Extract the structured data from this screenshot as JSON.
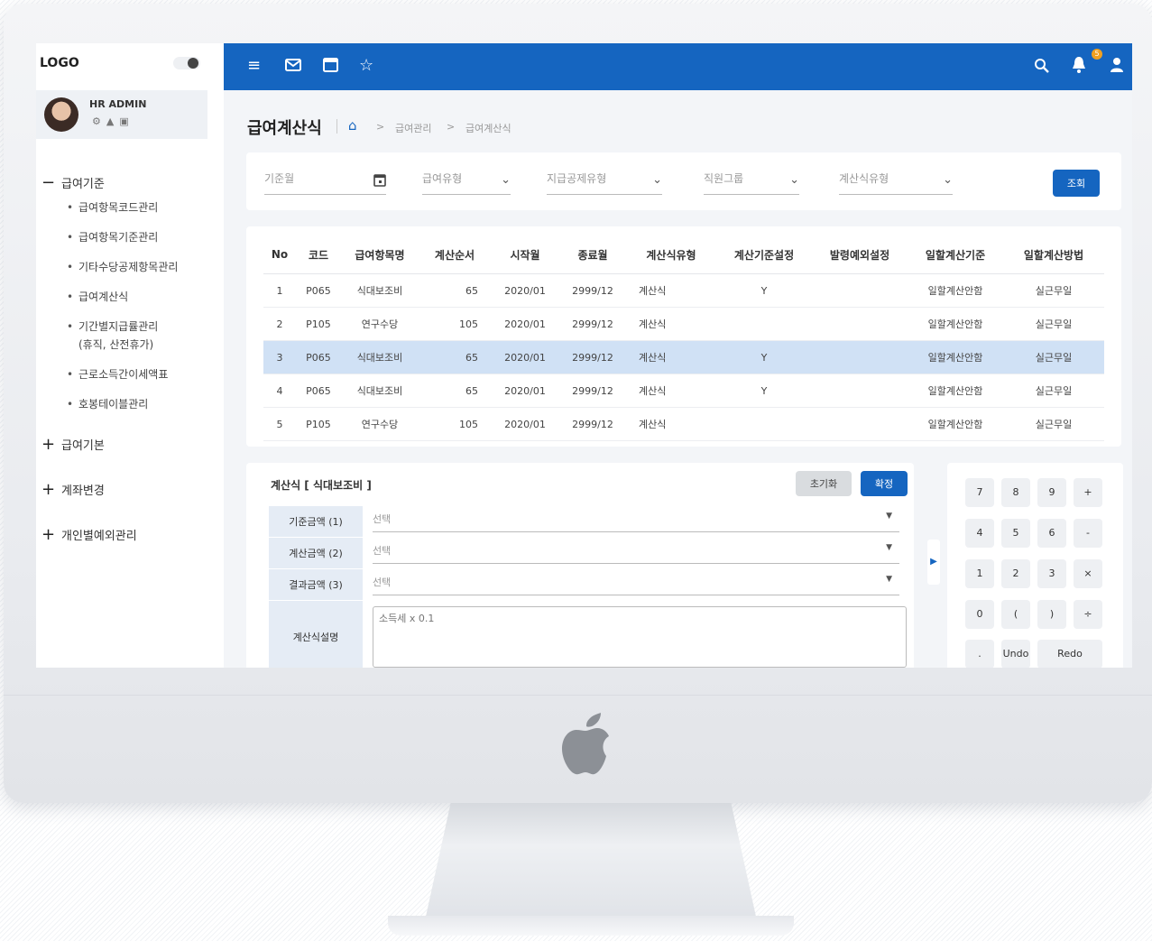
{
  "sidebar": {
    "logo": "LOGO",
    "profile": {
      "name": "HR ADMIN",
      "icons": [
        "gear-icon",
        "person-icon",
        "card-icon"
      ]
    },
    "groups": [
      {
        "sign": "−",
        "label": "급여기준",
        "expanded": true,
        "items": [
          "급여항목코드관리",
          "급여항목기준관리",
          "기타수당공제항목관리",
          "급여계산식",
          "기간별지급률관리",
          "(휴직, 산전휴가)",
          "근로소득간이세액표",
          "호봉테이블관리"
        ]
      },
      {
        "sign": "+",
        "label": "급여기본"
      },
      {
        "sign": "+",
        "label": "계좌변경"
      },
      {
        "sign": "+",
        "label": "개인별예외관리"
      }
    ]
  },
  "topbar": {
    "left_icons": [
      "menu-icon",
      "mail-icon",
      "calendar-icon",
      "star-icon"
    ],
    "right_icons": [
      "search-icon",
      "bell-icon",
      "user-icon"
    ],
    "notification_count": "5",
    "accent_color": "#1565c0"
  },
  "header": {
    "title": "급여계산식",
    "breadcrumb": [
      "급여관리",
      "급여계산식"
    ]
  },
  "filters": {
    "base_month_placeholder": "기준월",
    "pay_type_placeholder": "급여유형",
    "deduction_type_placeholder": "지급공제유형",
    "staff_group_placeholder": "직원그룹",
    "formula_type_placeholder": "계산식유형",
    "search_label": "조회"
  },
  "table": {
    "columns": [
      "No",
      "코드",
      "급여항목명",
      "계산순서",
      "시작월",
      "종료월",
      "계산식유형",
      "계산기준설정",
      "발령예외설정",
      "일할계산기준",
      "일할계산방법"
    ],
    "rows": [
      [
        "1",
        "P065",
        "식대보조비",
        "65",
        "2020/01",
        "2999/12",
        "계산식",
        "Y",
        "",
        "일할계산안함",
        "실근무일"
      ],
      [
        "2",
        "P105",
        "연구수당",
        "105",
        "2020/01",
        "2999/12",
        "계산식",
        "",
        "",
        "일할계산안함",
        "실근무일"
      ],
      [
        "3",
        "P065",
        "식대보조비",
        "65",
        "2020/01",
        "2999/12",
        "계산식",
        "Y",
        "",
        "일할계산안함",
        "실근무일"
      ],
      [
        "4",
        "P065",
        "식대보조비",
        "65",
        "2020/01",
        "2999/12",
        "계산식",
        "Y",
        "",
        "일할계산안함",
        "실근무일"
      ],
      [
        "5",
        "P105",
        "연구수당",
        "105",
        "2020/01",
        "2999/12",
        "계산식",
        "",
        "",
        "일할계산안함",
        "실근무일"
      ]
    ],
    "selected_row": 3
  },
  "formula": {
    "title": "계산식 [ 식대보조비 ]",
    "reset_label": "초기화",
    "confirm_label": "확정",
    "rows": [
      {
        "label": "기준금액 (1)",
        "value": "선택"
      },
      {
        "label": "계산금액 (2)",
        "value": "선택"
      },
      {
        "label": "결과금액 (3)",
        "value": "선택"
      }
    ],
    "description_label": "계산식설명",
    "description_placeholder": "소득세 x 0.1"
  },
  "calculator": {
    "keys": [
      "7",
      "8",
      "9",
      "+",
      "4",
      "5",
      "6",
      "-",
      "1",
      "2",
      "3",
      "×",
      "0",
      "(",
      ")",
      "÷",
      ".",
      "Undo",
      "Redo"
    ]
  }
}
